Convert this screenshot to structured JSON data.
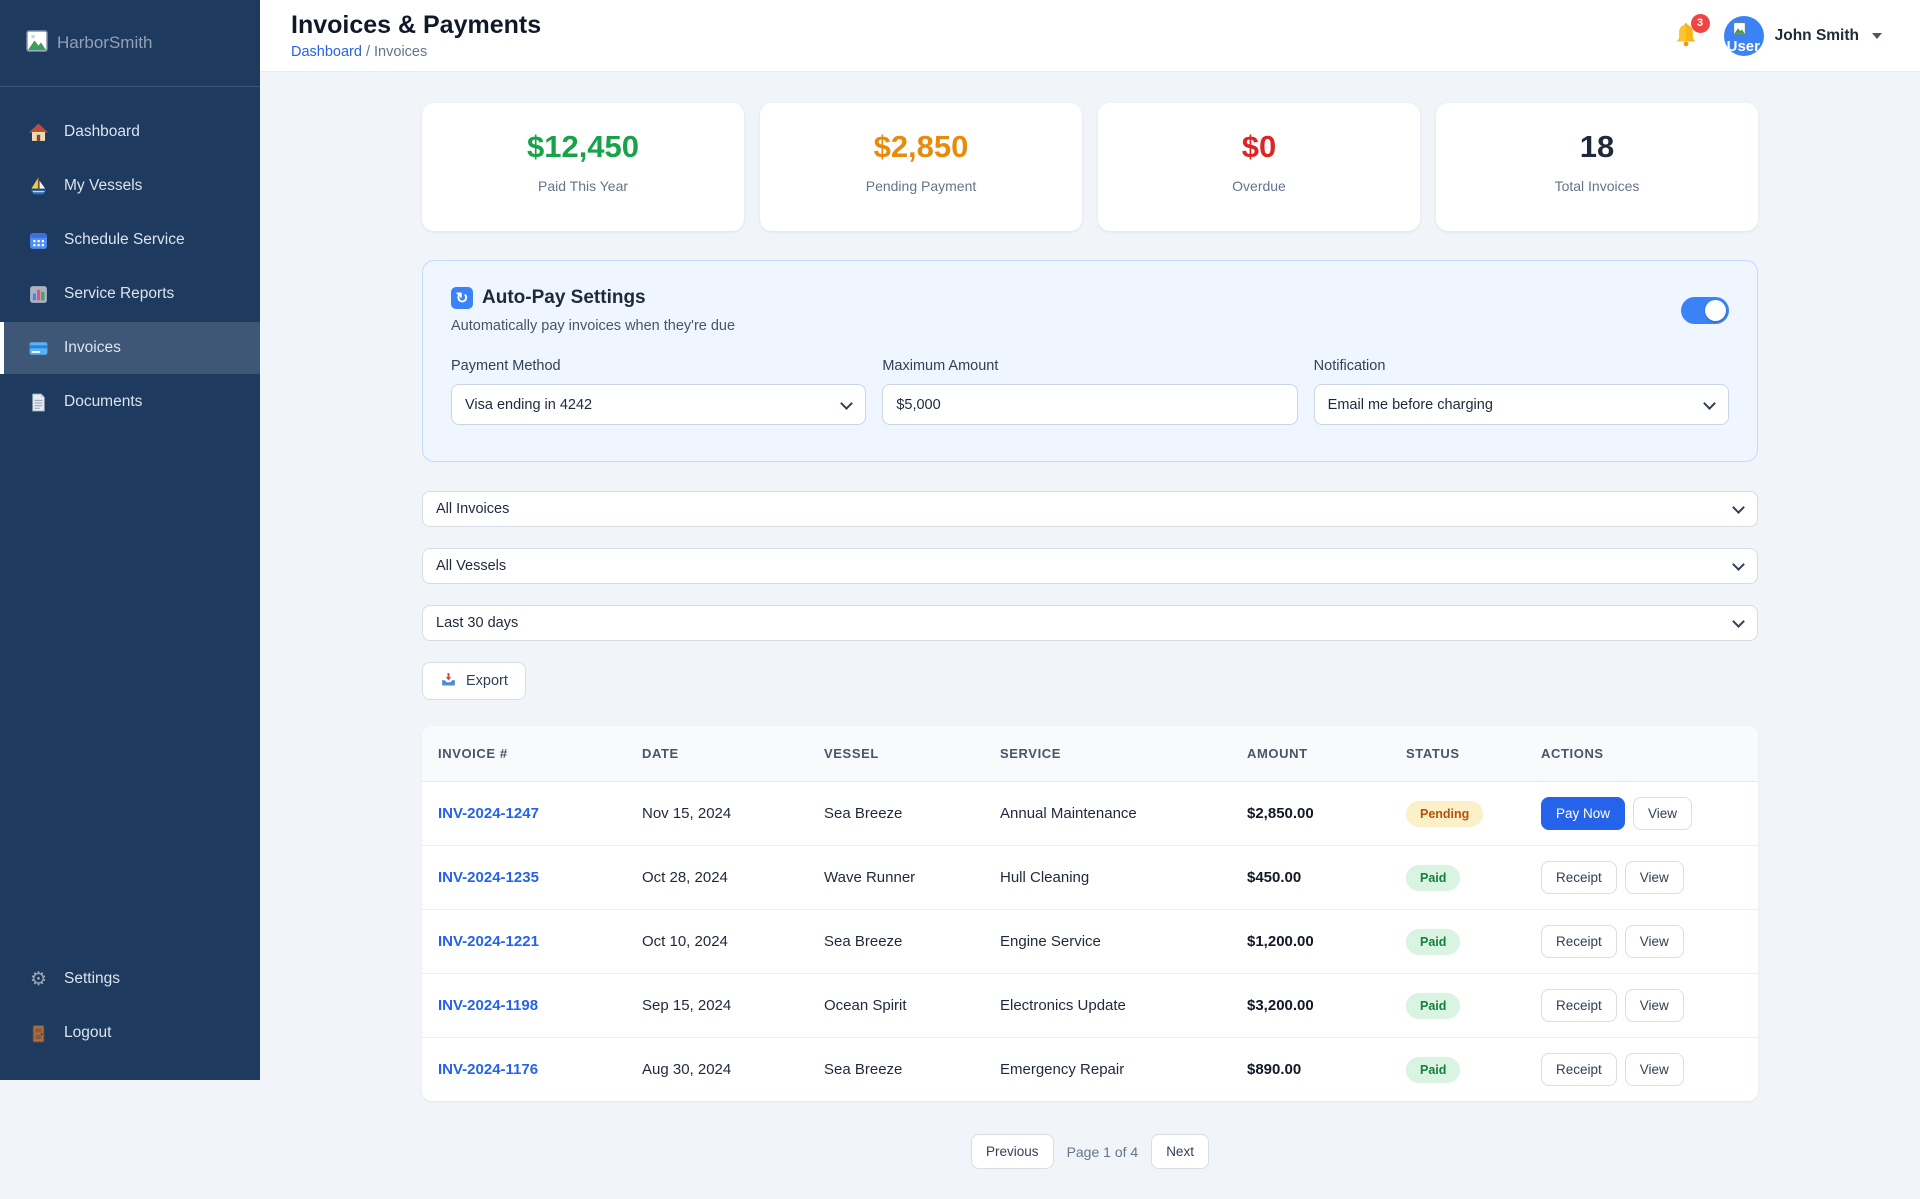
{
  "sidebar": {
    "logo_text": "HarborSmith",
    "items": [
      {
        "label": "Dashboard"
      },
      {
        "label": "My Vessels"
      },
      {
        "label": "Schedule Service"
      },
      {
        "label": "Service Reports"
      },
      {
        "label": "Invoices"
      },
      {
        "label": "Documents"
      }
    ],
    "footer_items": [
      {
        "label": "Settings"
      },
      {
        "label": "Logout"
      }
    ]
  },
  "header": {
    "title": "Invoices & Payments",
    "breadcrumb": {
      "link": "Dashboard",
      "separator": "/",
      "current": "Invoices"
    },
    "notification_badge": "3",
    "user": {
      "avatar_alt": "User",
      "name": "John Smith"
    }
  },
  "stats": [
    {
      "value": "$12,450",
      "label": "Paid This Year",
      "color": "#16a34a"
    },
    {
      "value": "$2,850",
      "label": "Pending Payment",
      "color": "#ea8a0c"
    },
    {
      "value": "$0",
      "label": "Overdue",
      "color": "#dc2626"
    },
    {
      "value": "18",
      "label": "Total Invoices",
      "color": "#1e293b"
    }
  ],
  "autopay": {
    "title": "Auto-Pay Settings",
    "subtitle": "Automatically pay invoices when they're due",
    "enabled": true,
    "toggle_color": "#3b82f6",
    "fields": {
      "payment_method": {
        "label": "Payment Method",
        "value": "Visa ending in 4242"
      },
      "maximum_amount": {
        "label": "Maximum Amount",
        "value": "$5,000"
      },
      "notification": {
        "label": "Notification",
        "value": "Email me before charging"
      }
    }
  },
  "filters": {
    "status": "All Invoices",
    "vessel": "All Vessels",
    "date_range": "Last 30 days",
    "export_label": "Export"
  },
  "table": {
    "columns": [
      "INVOICE #",
      "DATE",
      "VESSEL",
      "SERVICE",
      "AMOUNT",
      "STATUS",
      "ACTIONS"
    ],
    "rows": [
      {
        "invoice": "INV-2024-1247",
        "date": "Nov 15, 2024",
        "vessel": "Sea Breeze",
        "service": "Annual Maintenance",
        "amount": "$2,850.00",
        "status": "Pending",
        "actions": [
          "Pay Now",
          "View"
        ]
      },
      {
        "invoice": "INV-2024-1235",
        "date": "Oct 28, 2024",
        "vessel": "Wave Runner",
        "service": "Hull Cleaning",
        "amount": "$450.00",
        "status": "Paid",
        "actions": [
          "Receipt",
          "View"
        ]
      },
      {
        "invoice": "INV-2024-1221",
        "date": "Oct 10, 2024",
        "vessel": "Sea Breeze",
        "service": "Engine Service",
        "amount": "$1,200.00",
        "status": "Paid",
        "actions": [
          "Receipt",
          "View"
        ]
      },
      {
        "invoice": "INV-2024-1198",
        "date": "Sep 15, 2024",
        "vessel": "Ocean Spirit",
        "service": "Electronics Update",
        "amount": "$3,200.00",
        "status": "Paid",
        "actions": [
          "Receipt",
          "View"
        ]
      },
      {
        "invoice": "INV-2024-1176",
        "date": "Aug 30, 2024",
        "vessel": "Sea Breeze",
        "service": "Emergency Repair",
        "amount": "$890.00",
        "status": "Paid",
        "actions": [
          "Receipt",
          "View"
        ]
      }
    ]
  },
  "pagination": {
    "previous_label": "Previous",
    "page_text": "Page 1 of 4",
    "next_label": "Next"
  },
  "status_colors": {
    "pending_bg": "#fcf0c8",
    "pending_text": "#b45309",
    "paid_bg": "#d9f5e1",
    "paid_text": "#15803d"
  }
}
